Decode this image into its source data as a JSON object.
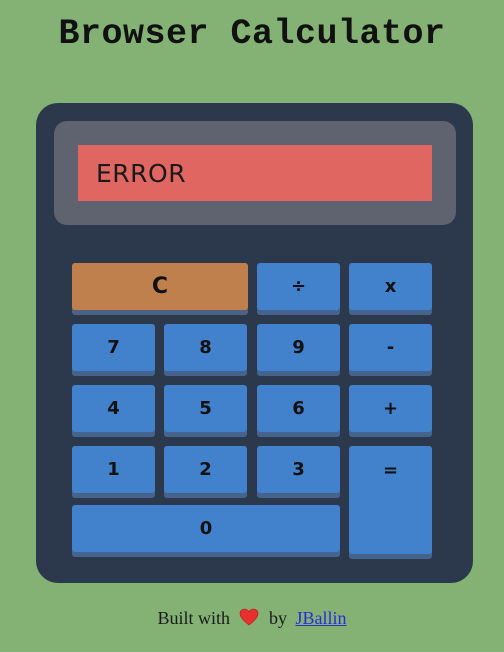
{
  "page_title": "Browser Calculator",
  "display": {
    "value": "ERROR"
  },
  "buttons": {
    "clear": "C",
    "divide": "÷",
    "multiply": "x",
    "seven": "7",
    "eight": "8",
    "nine": "9",
    "minus": "-",
    "four": "4",
    "five": "5",
    "six": "6",
    "plus": "+",
    "one": "1",
    "two": "2",
    "three": "3",
    "equals": "=",
    "zero": "0"
  },
  "footer": {
    "built_with": "Built with",
    "by": "by",
    "author_link": "JBallin"
  },
  "colors": {
    "background": "#84b274",
    "calculator_body": "#2c394c",
    "display_panel": "#5f6370",
    "display_screen": "#e06662",
    "button": "#4281cc",
    "clear_button": "#c0804e"
  },
  "icons": {
    "heart": "heart-icon"
  }
}
